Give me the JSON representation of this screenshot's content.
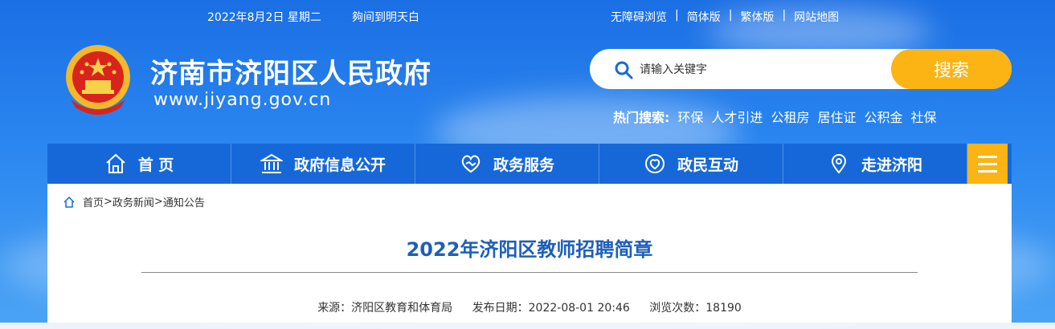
{
  "topbar": {
    "date": "2022年8月2日 星期二",
    "weather": "夠间到明天白",
    "links": [
      "无障碍浏览",
      "简体版",
      "繁体版",
      "网站地图"
    ]
  },
  "site": {
    "title": "济南市济阳区人民政府",
    "url": "www.jiyang.gov.cn"
  },
  "search": {
    "placeholder": "请输入关键字",
    "button_label": "搜索",
    "hot_label": "热门搜索:",
    "hot_items": [
      "环保",
      "人才引进",
      "公租房",
      "居住证",
      "公积金",
      "社保"
    ]
  },
  "nav": {
    "items": [
      {
        "label": "首 页",
        "icon": "home-icon"
      },
      {
        "label": "政府信息公开",
        "icon": "government-building-icon"
      },
      {
        "label": "政务服务",
        "icon": "handshake-heart-icon"
      },
      {
        "label": "政民互动",
        "icon": "people-heart-icon"
      },
      {
        "label": "走进济阳",
        "icon": "map-pin-icon"
      }
    ],
    "menu_icon": "hamburger-menu-icon"
  },
  "breadcrumb": {
    "items": [
      "首页",
      "政务新闻",
      "通知公告"
    ],
    "separator": ">"
  },
  "article": {
    "title": "2022年济阳区教师招聘简章",
    "source": "来源：济阳区教育和体育局",
    "date": "发布日期：2022-08-01 20:46",
    "views": "浏览次数：18190"
  },
  "colors": {
    "brand_blue": "#1668d9",
    "accent_yellow": "#fbb414",
    "title_blue": "#1e5fb8"
  }
}
